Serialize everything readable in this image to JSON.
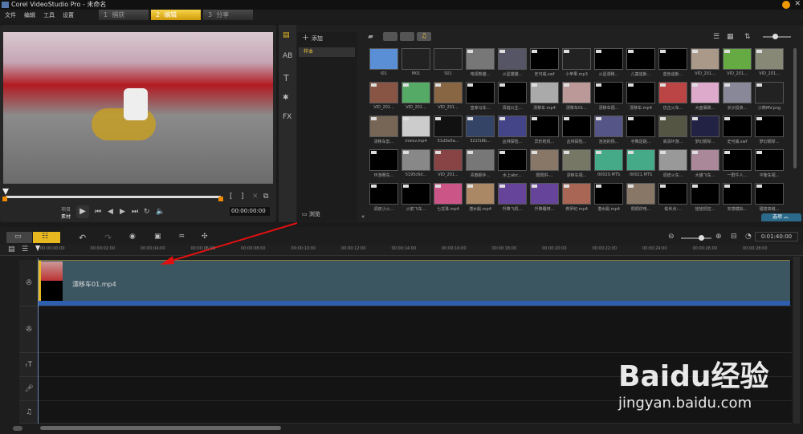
{
  "window": {
    "title": "Corel VideoStudio Pro - 未命名"
  },
  "menu": [
    "文件",
    "编辑",
    "工具",
    "设置"
  ],
  "steps": [
    {
      "num": "1",
      "label": "捕获",
      "active": false
    },
    {
      "num": "2",
      "label": "编辑",
      "active": true
    },
    {
      "num": "3",
      "label": "分享",
      "active": false
    }
  ],
  "preview": {
    "mode_project": "项目",
    "mode_clip": "素材",
    "timecode": "00:00:00:00",
    "mark_in": "[",
    "mark_out": "]"
  },
  "library": {
    "add_label": "添加",
    "folder": "样本",
    "browse_label": "浏览",
    "options_label": "选项",
    "items": [
      [
        "I01",
        "M01",
        "S01",
        "电视熊猫...",
        "火星猫猫...",
        "史可威.swf",
        "小苹果.mp3",
        "火星漫移...",
        "儿童迪斯...",
        "蓝色迪斯...",
        "VID_201...",
        "VID_201...",
        "VID_201..."
      ],
      [
        "VID_201...",
        "VID_201...",
        "VID_201...",
        "皇家马车...",
        "青蛙公主...",
        "漂移车.mp4",
        "漂移车01...",
        "漂移车视...",
        "漂移车.mp4",
        "仿古火车...",
        "大盘暴跌...",
        "长沙投资...",
        "小熊MV.png"
      ],
      [
        "漂移车剪...",
        "meisv.mp4",
        "51d3e0a...",
        "321f18b...",
        "丛林探险...",
        "异形枪机...",
        "丛林探险...",
        "泡泡的扬...",
        "手舞足蹈...",
        "高清环游...",
        "梦幻钢琴...",
        "史可威.swf",
        "梦幻钢琴..."
      ],
      [
        "环游赛车...",
        "5195c6d...",
        "VID_201...",
        "青春期手...",
        "水上abc...",
        "焗焗供-...",
        "漂移车视...",
        "00020.MTS",
        "00021.MTS",
        "调皮火车...",
        "大猫飞车...",
        "一群牛人...",
        "平衡车视..."
      ],
      [
        "调皮小火...",
        "火箭飞车...",
        "七龙珠.mp4",
        "潜水艇.mp4",
        "升降飞机...",
        "升降睡椅...",
        "侏罗纪.mp4",
        "潜水艇.mp4",
        "焗焗供电...",
        "偷米点:...",
        "娃娃机控...",
        "实感模拟...",
        "碰撞高缝..."
      ]
    ],
    "thumb_colors": [
      [
        "#5a8fd6",
        "#222",
        "#222",
        "#777",
        "#556",
        "#000",
        "#222",
        "#000",
        "#000",
        "#000",
        "#a98",
        "#6a4",
        "#887"
      ],
      [
        "#854",
        "#5a6",
        "#864",
        "#000",
        "#000",
        "#aaa",
        "#b99",
        "#000",
        "#000",
        "#b44",
        "#dac",
        "#889",
        "#222"
      ],
      [
        "#765",
        "#ccc",
        "#111",
        "#346",
        "#448",
        "#000",
        "#000",
        "#558",
        "#000",
        "#554",
        "#224",
        "#000",
        "#000"
      ],
      [
        "#000",
        "#888",
        "#844",
        "#777",
        "#000",
        "#876",
        "#776",
        "#4a8",
        "#4a8",
        "#999",
        "#a89",
        "#000",
        "#000"
      ],
      [
        "#000",
        "#000",
        "#c58",
        "#a86",
        "#649",
        "#649",
        "#a65",
        "#000",
        "#876",
        "#000",
        "#000",
        "#000",
        "#000"
      ]
    ]
  },
  "timeline": {
    "total_time": "0:01:40:00",
    "ruler": [
      "00:00:00:00",
      "00:00:02:00",
      "00:00:04:00",
      "00:00:06:00",
      "00:00:08:00",
      "00:00:10:00",
      "00:00:12:00",
      "00:00:14:00",
      "00:00:16:00",
      "00:00:18:00",
      "00:00:20:00",
      "00:00:22:00",
      "00:00:24:00",
      "00:00:26:00",
      "00:00:28:00"
    ],
    "clip_name": "漂移车01.mp4"
  },
  "watermark": {
    "brand": "Baidu经验",
    "url": "jingyan.baidu.com"
  },
  "colors": {
    "accent": "#f0c020",
    "clip": "#3b5561",
    "clip_bar": "#2e5fae"
  }
}
